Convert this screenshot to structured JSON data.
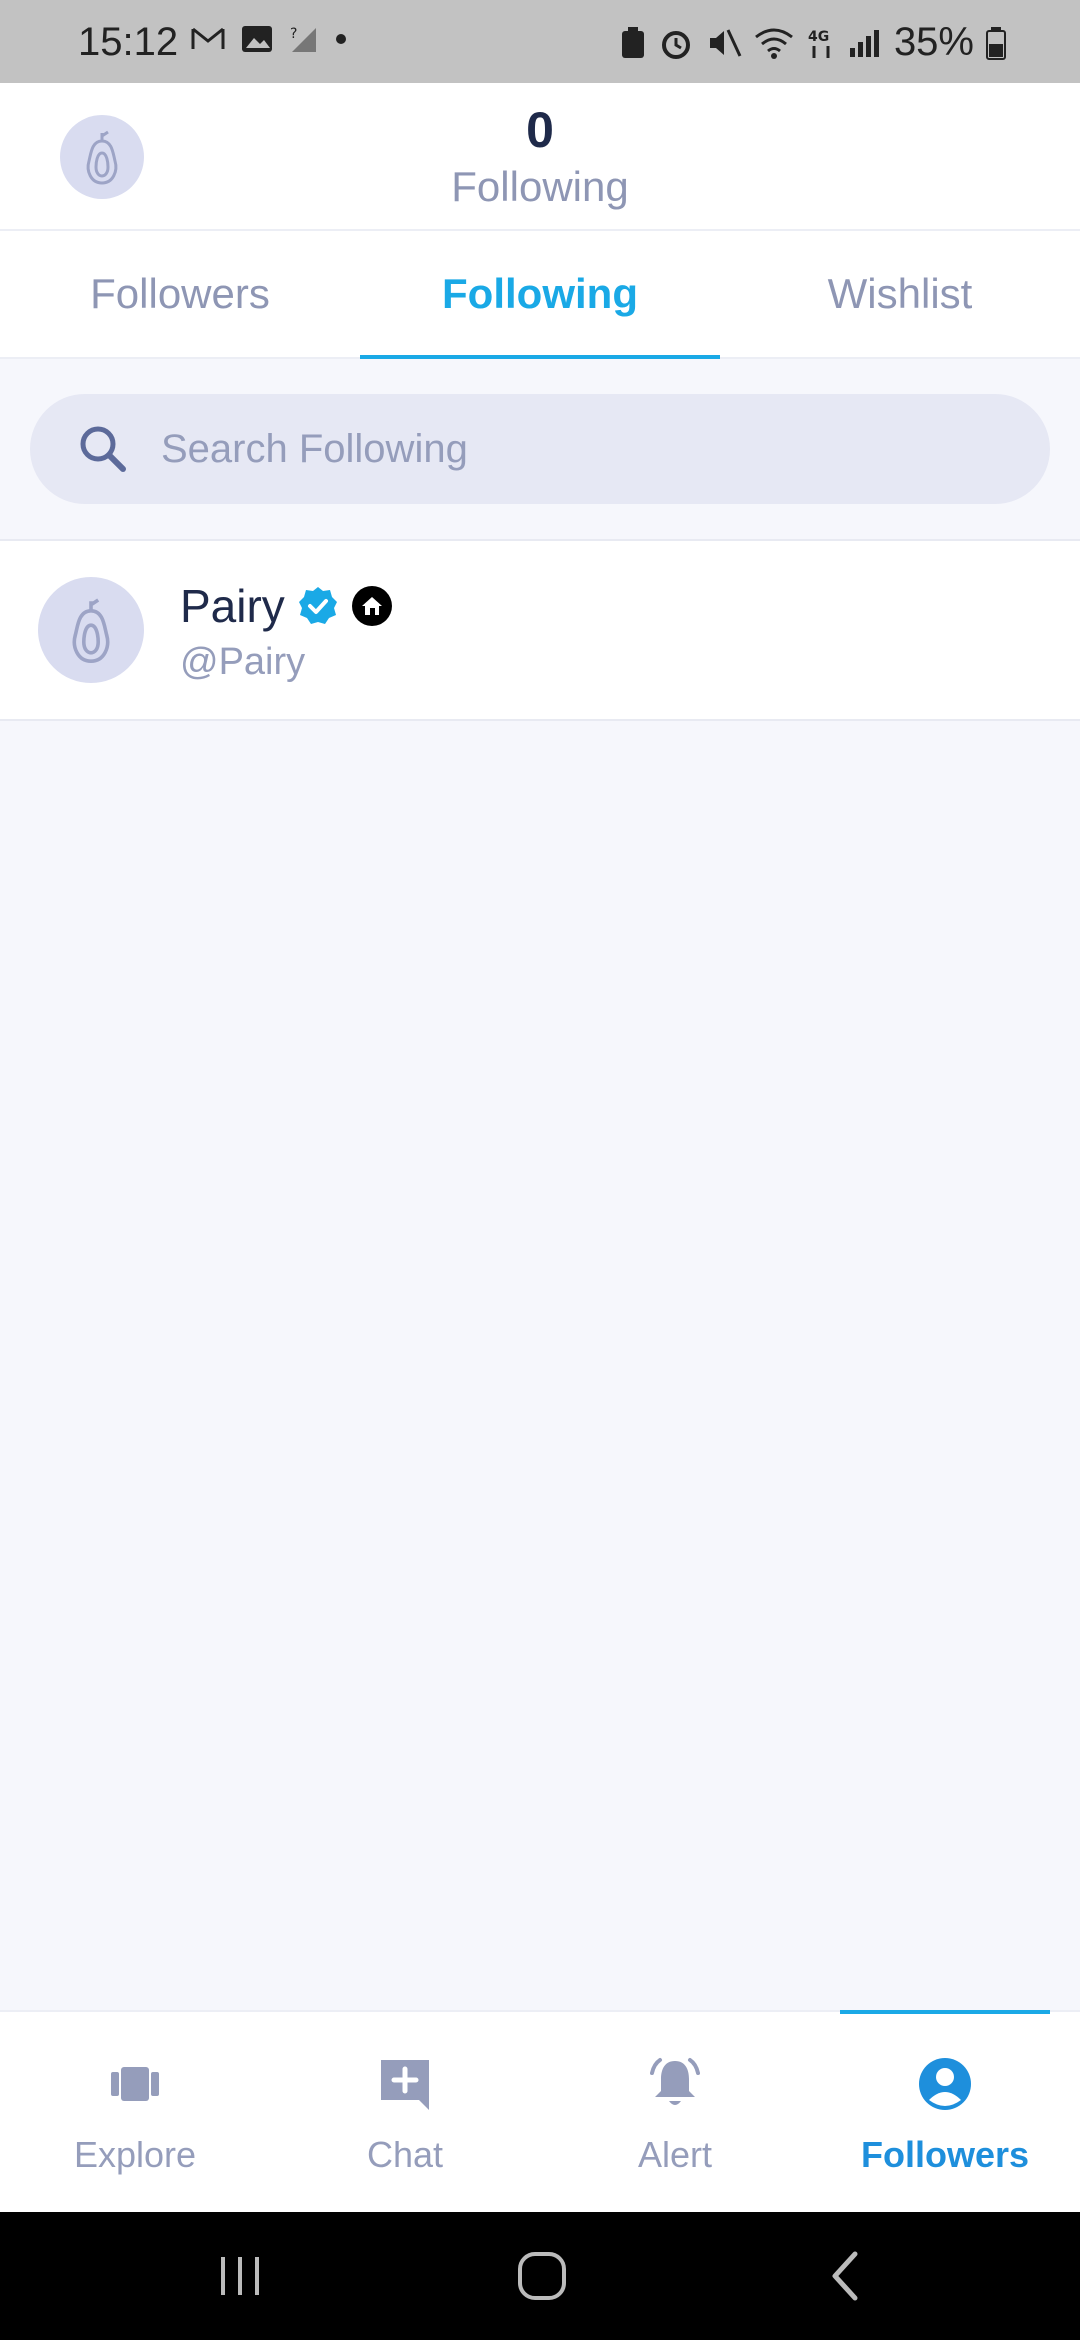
{
  "status_bar": {
    "time": "15:12",
    "battery": "35%",
    "left_icons": [
      "gmail-icon",
      "gallery-icon",
      "no-signal-icon",
      "dot-icon"
    ],
    "right_icons": [
      "battery-saver-icon",
      "alarm-icon",
      "mute-icon",
      "wifi-icon",
      "4g-icon",
      "signal-icon",
      "battery-icon"
    ]
  },
  "header": {
    "count": "0",
    "label": "Following"
  },
  "tabs": [
    {
      "label": "Followers",
      "active": false
    },
    {
      "label": "Following",
      "active": true
    },
    {
      "label": "Wishlist",
      "active": false
    }
  ],
  "search": {
    "placeholder": "Search Following",
    "value": ""
  },
  "following_list": [
    {
      "name": "Pairy",
      "handle": "@Pairy",
      "verified": true,
      "badge_icon": "house-badge-icon"
    }
  ],
  "bottom_nav": [
    {
      "label": "Explore",
      "icon": "explore-icon",
      "active": false
    },
    {
      "label": "Chat",
      "icon": "chat-add-icon",
      "active": false
    },
    {
      "label": "Alert",
      "icon": "bell-icon",
      "active": false
    },
    {
      "label": "Followers",
      "icon": "user-circle-icon",
      "active": true
    }
  ],
  "colors": {
    "accent": "#1aa9e6",
    "muted": "#8e96b4",
    "text": "#1f2a4a",
    "background": "#f6f7fc"
  }
}
